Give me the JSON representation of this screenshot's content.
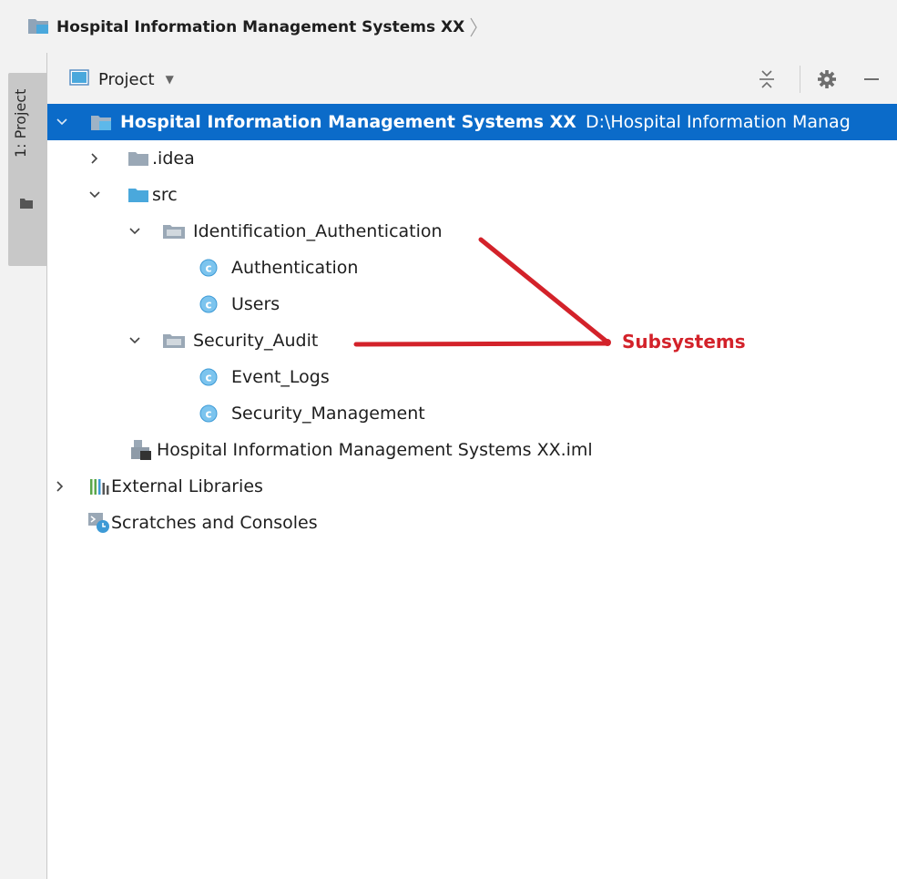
{
  "breadcrumb": {
    "project_label": "Hospital Information Management Systems XX"
  },
  "tool_window": {
    "tab_label": "1: Project"
  },
  "project_header": {
    "view_label": "Project"
  },
  "tree": {
    "root": {
      "label": "Hospital Information Management Systems XX",
      "path": "D:\\Hospital Information Manag"
    },
    "idea": {
      "label": ".idea"
    },
    "src": {
      "label": "src"
    },
    "identification_authentication": {
      "label": "Identification_Authentication"
    },
    "authentication": {
      "label": "Authentication"
    },
    "users": {
      "label": "Users"
    },
    "security_audit": {
      "label": "Security_Audit"
    },
    "event_logs": {
      "label": "Event_Logs"
    },
    "security_management": {
      "label": "Security_Management"
    },
    "iml_file": {
      "label": "Hospital Information Management Systems XX.iml"
    },
    "external_libraries": {
      "label": "External Libraries"
    },
    "scratches": {
      "label": "Scratches and Consoles"
    }
  },
  "annotation": {
    "label": "Subsystems",
    "color": "#d3222a"
  },
  "colors": {
    "selection": "#0b6bc9",
    "folder": "#8fa4b8",
    "source_folder": "#4aa8dc",
    "class_icon": "#3d9ad6"
  },
  "icons": {
    "project_folder": "project-folder-icon",
    "folder": "folder-icon",
    "class": "class-c-icon",
    "module_file": "module-file-icon",
    "libraries": "libraries-icon",
    "scratches": "scratches-icon",
    "collapse_all": "collapse-all-icon",
    "settings": "gear-icon",
    "hide": "minimize-icon"
  }
}
